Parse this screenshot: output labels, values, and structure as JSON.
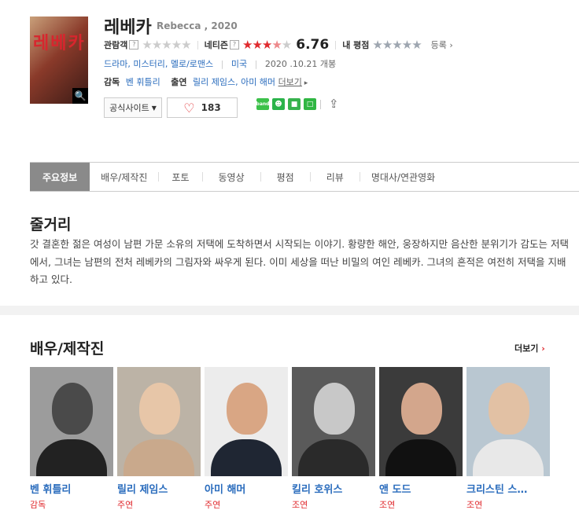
{
  "movie": {
    "title": "레베카",
    "original_title": "Rebecca , 2020",
    "poster_text": "레베카"
  },
  "ratings": {
    "audience_label": "관람객",
    "netizen_label": "네티즌",
    "netizen_score": "6.76",
    "netizen_stars": 3.5,
    "my_label": "내 평점",
    "register": "등록",
    "help": "?"
  },
  "meta": {
    "genres": [
      "드라마",
      "미스터리",
      "멜로/로맨스"
    ],
    "country": "미국",
    "release": "2020 .10.21 개봉"
  },
  "crew": {
    "director_label": "감독",
    "director": "벤 휘틀리",
    "cast_label": "출연",
    "cast": "릴리 제임스, 아미 해머",
    "more": "더보기"
  },
  "buttons": {
    "official_site": "공식사이트",
    "likes": "183"
  },
  "tabs": [
    "주요정보",
    "배우/제작진",
    "포토",
    "동영상",
    "평점",
    "리뷰",
    "명대사/연관영화"
  ],
  "synopsis": {
    "heading": "줄거리",
    "text": "갓 결혼한 젊은 여성이 남편 가문 소유의 저택에 도착하면서 시작되는 이야기. 황량한 해안, 웅장하지만 음산한 분위기가 감도는 저택에서, 그녀는 남편의 전처 레베카의 그림자와 싸우게 된다. 이미 세상을 떠난 비밀의 여인 레베카. 그녀의 흔적은 여전히 저택을 지배하고 있다."
  },
  "cast_section": {
    "heading": "배우/제작진",
    "more": "더보기",
    "people": [
      {
        "name": "벤 휘틀리",
        "role": "감독"
      },
      {
        "name": "릴리 제임스",
        "role": "주연"
      },
      {
        "name": "아미 해머",
        "role": "주연"
      },
      {
        "name": "킬리 호위스",
        "role": "조연"
      },
      {
        "name": "앤 도드",
        "role": "조연"
      },
      {
        "name": "크리스틴 스…",
        "role": "조연"
      }
    ]
  },
  "colors": {
    "accent_red": "#e02a2e",
    "link_blue": "#2a6cbd",
    "tab_active": "#8a8a8a"
  }
}
